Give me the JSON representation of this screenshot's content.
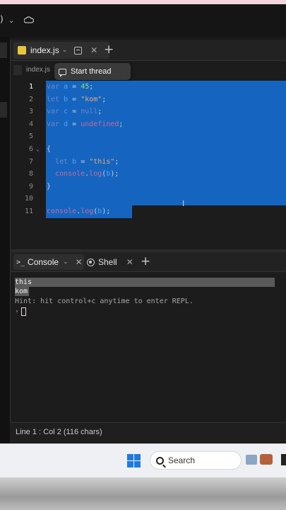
{
  "editor": {
    "tab_label": "index.js",
    "breadcrumb": "index.js",
    "tooltip": "Start thread",
    "lines": [
      {
        "num": "1",
        "tokens": [
          [
            "kw",
            "var"
          ],
          [
            "punc",
            " "
          ],
          [
            "var",
            "a"
          ],
          [
            "punc",
            " = "
          ],
          [
            "num",
            "45"
          ],
          [
            "punc",
            ";"
          ]
        ]
      },
      {
        "num": "2",
        "tokens": [
          [
            "kw",
            "let"
          ],
          [
            "punc",
            " "
          ],
          [
            "var",
            "b"
          ],
          [
            "punc",
            " = "
          ],
          [
            "str",
            "\"kom\""
          ],
          [
            "punc",
            ";"
          ]
        ]
      },
      {
        "num": "3",
        "tokens": [
          [
            "kw",
            "var"
          ],
          [
            "punc",
            " "
          ],
          [
            "var",
            "c"
          ],
          [
            "punc",
            " = "
          ],
          [
            "nul",
            "null"
          ],
          [
            "punc",
            ";"
          ]
        ]
      },
      {
        "num": "4",
        "tokens": [
          [
            "kw",
            "var"
          ],
          [
            "punc",
            " "
          ],
          [
            "var",
            "d"
          ],
          [
            "punc",
            " = "
          ],
          [
            "undef",
            "undefined"
          ],
          [
            "punc",
            ";"
          ]
        ]
      },
      {
        "num": "5",
        "tokens": []
      },
      {
        "num": "6",
        "tokens": [
          [
            "punc",
            "{"
          ]
        ]
      },
      {
        "num": "7",
        "tokens": [
          [
            "punc",
            "  "
          ],
          [
            "kw",
            "let"
          ],
          [
            "punc",
            " "
          ],
          [
            "var",
            "b"
          ],
          [
            "punc",
            " = "
          ],
          [
            "str",
            "\"this\""
          ],
          [
            "punc",
            ";"
          ]
        ]
      },
      {
        "num": "8",
        "tokens": [
          [
            "punc",
            "  "
          ],
          [
            "cons",
            "console"
          ],
          [
            "punc",
            "."
          ],
          [
            "fn",
            "log"
          ],
          [
            "punc",
            "("
          ],
          [
            "var",
            "b"
          ],
          [
            "punc",
            ");"
          ]
        ]
      },
      {
        "num": "9",
        "tokens": [
          [
            "punc",
            "}"
          ]
        ]
      },
      {
        "num": "10",
        "tokens": []
      },
      {
        "num": "11",
        "tokens": [
          [
            "cons",
            "console"
          ],
          [
            "punc",
            "."
          ],
          [
            "fn",
            "log"
          ],
          [
            "punc",
            "("
          ],
          [
            "var",
            "b"
          ],
          [
            "punc",
            ");"
          ]
        ]
      }
    ]
  },
  "console": {
    "tab_label": "Console",
    "shell_label": "Shell",
    "output": [
      "this",
      "kom"
    ],
    "hint": "Hint: hit control+c anytime to enter REPL."
  },
  "status": {
    "text": "Line 1 : Col 2 (116 chars)"
  },
  "taskbar": {
    "search_label": "Search"
  },
  "colors": {
    "selection": "#1565c0",
    "js_badge": "#e9c53a",
    "windows_blue": "#1f7ae0"
  }
}
